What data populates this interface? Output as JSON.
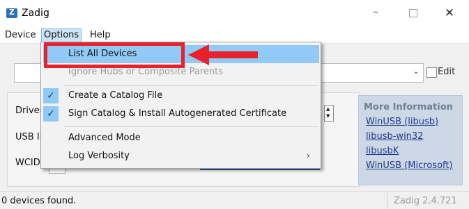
{
  "window": {
    "title": "Zadig",
    "icon": "zadig-app-icon",
    "controls": {
      "minimize": "–",
      "maximize": "□",
      "close": "✕"
    }
  },
  "menubar": {
    "items": [
      {
        "label": "Device"
      },
      {
        "label": "Options"
      },
      {
        "label": "Help"
      }
    ]
  },
  "options_menu": {
    "items": [
      {
        "label": "List All Devices",
        "checked": false,
        "highlighted": true,
        "enabled": true
      },
      {
        "label": "Ignore Hubs or Composite Parents",
        "checked": false,
        "enabled": false
      },
      {
        "label": "Create a Catalog File",
        "checked": true,
        "enabled": true
      },
      {
        "label": "Sign Catalog & Install Autogenerated Certificate",
        "checked": true,
        "enabled": true
      },
      {
        "label": "Advanced Mode",
        "checked": false,
        "enabled": true
      },
      {
        "label": "Log Verbosity",
        "checked": false,
        "enabled": true,
        "submenu": "›"
      }
    ]
  },
  "main": {
    "edit_label": "Edit",
    "combo_arrow": "⌄",
    "fields": {
      "driver": "Driver",
      "usb_id": "USB ID",
      "wcid": "WCID"
    }
  },
  "info_panel": {
    "title": "More Information",
    "links": [
      "WinUSB (libusb)",
      "libusb-win32",
      "libusbK",
      "WinUSB (Microsoft)"
    ]
  },
  "statusbar": {
    "status": "0 devices found.",
    "version": "Zadig 2.4.721"
  },
  "annotation": {
    "highlight_color": "#e8212b",
    "target": "List All Devices"
  }
}
